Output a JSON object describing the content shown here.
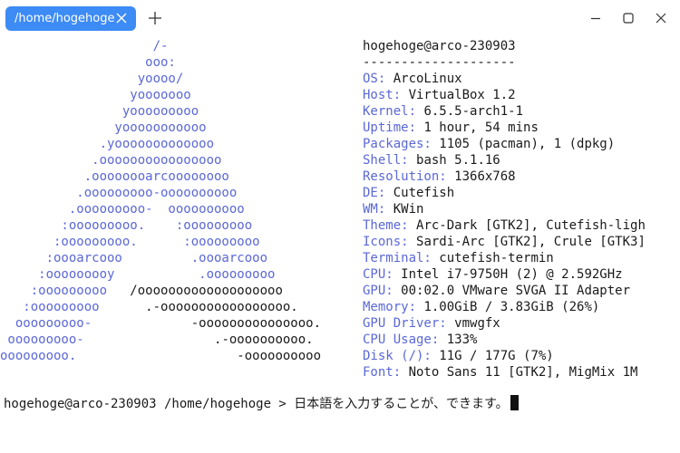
{
  "tab": {
    "label": "/home/hogehoge"
  },
  "icons": {
    "tab_close": "close-icon",
    "new_tab": "plus-icon",
    "minimize": "minimize-icon",
    "maximize": "maximize-icon",
    "close": "close-icon"
  },
  "colors": {
    "accent": "#3d8bf5",
    "logo_blue": "#5b68d6",
    "text": "#1a1a1a"
  },
  "logo": [
    [
      {
        "t": "                    /-",
        "c": "blue"
      }
    ],
    [
      {
        "t": "                   ooo:",
        "c": "blue"
      }
    ],
    [
      {
        "t": "                  yoooo/",
        "c": "blue"
      }
    ],
    [
      {
        "t": "                 yooooooo",
        "c": "blue"
      }
    ],
    [
      {
        "t": "                yooooooooo",
        "c": "blue"
      }
    ],
    [
      {
        "t": "               yooooooooooo",
        "c": "blue"
      }
    ],
    [
      {
        "t": "             .yooooooooooooo",
        "c": "blue"
      }
    ],
    [
      {
        "t": "            .oooooooooooooooo",
        "c": "blue"
      }
    ],
    [
      {
        "t": "           .oooooooarcoooooooo",
        "c": "blue"
      }
    ],
    [
      {
        "t": "          .ooooooooo-oooooooooo",
        "c": "blue"
      }
    ],
    [
      {
        "t": "         .ooooooooo-  oooooooooo",
        "c": "blue"
      }
    ],
    [
      {
        "t": "        :ooooooooo.    :ooooooooo",
        "c": "blue"
      }
    ],
    [
      {
        "t": "       :ooooooooo.      :ooooooooo",
        "c": "blue"
      }
    ],
    [
      {
        "t": "      :oooarcooo         .oooarcooo",
        "c": "blue"
      }
    ],
    [
      {
        "t": "     :ooooooooy           .ooooooooo",
        "c": "blue"
      }
    ],
    [
      {
        "t": "    :ooooooooo   ",
        "c": "blue"
      },
      {
        "t": "/ooooooooooooooooooo",
        "c": "dark"
      }
    ],
    [
      {
        "t": "   :ooooooooo      ",
        "c": "blue"
      },
      {
        "t": ".-ooooooooooooooooo.",
        "c": "dark"
      }
    ],
    [
      {
        "t": "  ooooooooo-             ",
        "c": "blue"
      },
      {
        "t": "-ooooooooooooooo.",
        "c": "dark"
      }
    ],
    [
      {
        "t": " ooooooooo-                 ",
        "c": "blue"
      },
      {
        "t": ".-oooooooooo.",
        "c": "dark"
      }
    ],
    [
      {
        "t": "ooooooooo.                     ",
        "c": "blue"
      },
      {
        "t": "-oooooooooo",
        "c": "dark"
      }
    ]
  ],
  "info": [
    {
      "key": "",
      "value": "hogehoge@arco-230903"
    },
    {
      "key": "",
      "value": "--------------------"
    },
    {
      "key": "OS: ",
      "value": "ArcoLinux"
    },
    {
      "key": "Host: ",
      "value": "VirtualBox 1.2"
    },
    {
      "key": "Kernel: ",
      "value": "6.5.5-arch1-1"
    },
    {
      "key": "Uptime: ",
      "value": "1 hour, 54 mins"
    },
    {
      "key": "Packages: ",
      "value": "1105 (pacman), 1 (dpkg)"
    },
    {
      "key": "Shell: ",
      "value": "bash 5.1.16"
    },
    {
      "key": "Resolution: ",
      "value": "1366x768"
    },
    {
      "key": "DE: ",
      "value": "Cutefish"
    },
    {
      "key": "WM: ",
      "value": "KWin"
    },
    {
      "key": "Theme: ",
      "value": "Arc-Dark [GTK2], Cutefish-ligh"
    },
    {
      "key": "Icons: ",
      "value": "Sardi-Arc [GTK2], Crule [GTK3]"
    },
    {
      "key": "Terminal: ",
      "value": "cutefish-termin"
    },
    {
      "key": "CPU: ",
      "value": "Intel i7-9750H (2) @ 2.592GHz"
    },
    {
      "key": "GPU: ",
      "value": "00:02.0 VMware SVGA II Adapter"
    },
    {
      "key": "Memory: ",
      "value": "1.00GiB / 3.83GiB (26%)"
    },
    {
      "key": "GPU Driver: ",
      "value": "vmwgfx"
    },
    {
      "key": "CPU Usage: ",
      "value": "133%"
    },
    {
      "key": "Disk (/): ",
      "value": "11G / 177G (7%)"
    },
    {
      "key": "Font: ",
      "value": "Noto Sans 11 [GTK2], MigMix 1M"
    }
  ],
  "prompt": {
    "text": "hogehoge@arco-230903 /home/hogehoge > ",
    "input": "日本語を入力することが、できます。"
  }
}
